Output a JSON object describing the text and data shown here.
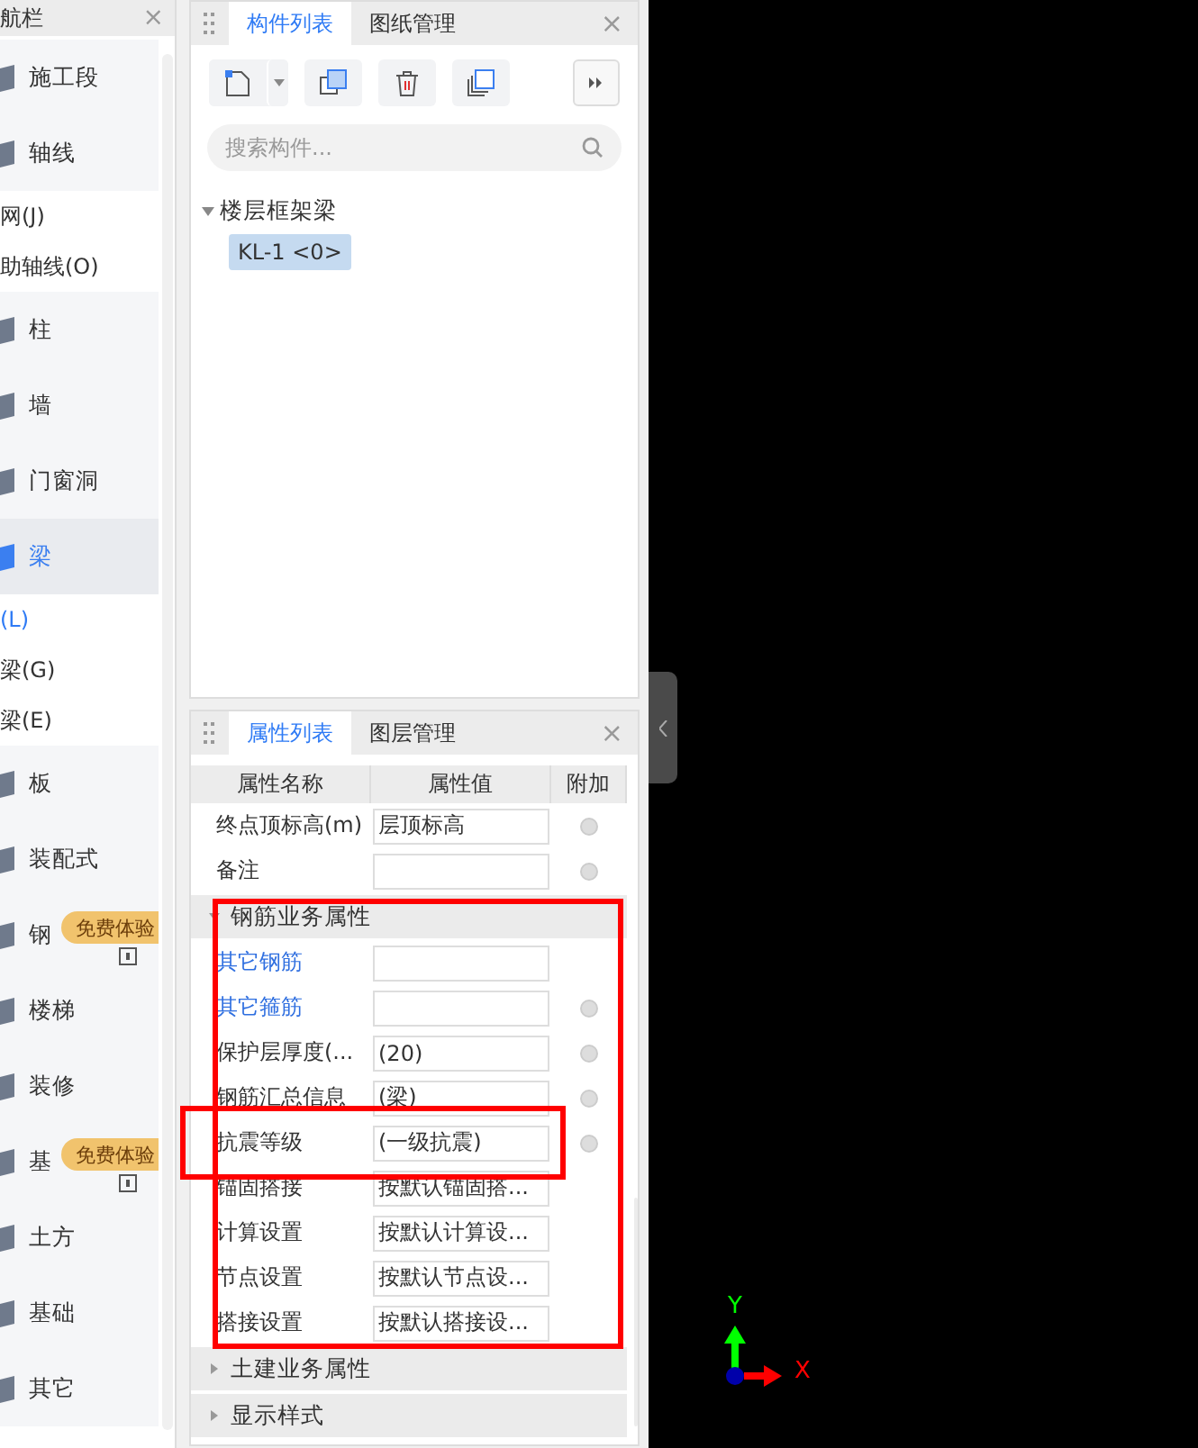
{
  "sidebar": {
    "title": "航栏",
    "close": "×",
    "items": [
      {
        "label": "施工段",
        "selected": false
      },
      {
        "label": "轴线",
        "selected": false,
        "children": [
          {
            "label": "网(J)",
            "selected": false
          },
          {
            "label": "助轴线(O)",
            "selected": false
          }
        ]
      },
      {
        "label": "柱",
        "selected": false
      },
      {
        "label": "墙",
        "selected": false
      },
      {
        "label": "门窗洞",
        "selected": false
      },
      {
        "label": "梁",
        "selected": true,
        "children": [
          {
            "label": "(L)",
            "selected": true
          },
          {
            "label": "梁(G)",
            "selected": false
          },
          {
            "label": "梁(E)",
            "selected": false
          }
        ]
      },
      {
        "label": "板",
        "selected": false
      },
      {
        "label": "装配式",
        "selected": false
      },
      {
        "label": "钢",
        "selected": false,
        "badge": "免费体验"
      },
      {
        "label": "楼梯",
        "selected": false
      },
      {
        "label": "装修",
        "selected": false
      },
      {
        "label": "基",
        "selected": false,
        "badge": "免费体验"
      },
      {
        "label": "土方",
        "selected": false
      },
      {
        "label": "基础",
        "selected": false
      },
      {
        "label": "其它",
        "selected": false
      }
    ]
  },
  "component_panel": {
    "tabs": [
      {
        "label": "构件列表",
        "selected": true
      },
      {
        "label": "图纸管理",
        "selected": false
      }
    ],
    "close": "×",
    "search": {
      "placeholder": "搜索构件..."
    },
    "tree": [
      {
        "label": "楼层框架梁",
        "expanded": true,
        "children": [
          {
            "label": "KL-1 <0>",
            "selected": true
          }
        ]
      }
    ]
  },
  "property_panel": {
    "tabs": [
      {
        "label": "属性列表",
        "selected": true
      },
      {
        "label": "图层管理",
        "selected": false
      }
    ],
    "close": "×",
    "columns": [
      "属性名称",
      "属性值",
      "附加"
    ],
    "rows": [
      {
        "kind": "row",
        "name": "终点顶标高(m)",
        "value": "层顶标高",
        "attach": true
      },
      {
        "kind": "row",
        "name": "备注",
        "attach": true
      },
      {
        "kind": "group",
        "label": "钢筋业务属性",
        "expanded": true,
        "children": [
          {
            "kind": "row",
            "name": "其它钢筋",
            "link": true,
            "attach": false
          },
          {
            "kind": "row",
            "name": "其它箍筋",
            "link": true,
            "attach": true
          },
          {
            "kind": "row",
            "name": "保护层厚度(...",
            "value": "(20)",
            "attach": true
          },
          {
            "kind": "row",
            "name": "钢筋汇总信息",
            "value": "(梁)",
            "attach": true
          },
          {
            "kind": "row",
            "name": "抗震等级",
            "value": "(一级抗震)",
            "attach": true
          },
          {
            "kind": "row",
            "name": "锚固搭接",
            "value": "按默认锚固搭...",
            "attach": false
          },
          {
            "kind": "row",
            "name": "计算设置",
            "value": "按默认计算设...",
            "attach": false
          },
          {
            "kind": "row",
            "name": "节点设置",
            "value": "按默认节点设...",
            "attach": false
          },
          {
            "kind": "row",
            "name": "搭接设置",
            "value": "按默认搭接设...",
            "attach": false
          }
        ]
      },
      {
        "kind": "group",
        "label": "土建业务属性",
        "expanded": false
      },
      {
        "kind": "group",
        "label": "显示样式",
        "expanded": false
      }
    ]
  },
  "canvas": {
    "axis_y": "Y",
    "axis_x": "X"
  }
}
